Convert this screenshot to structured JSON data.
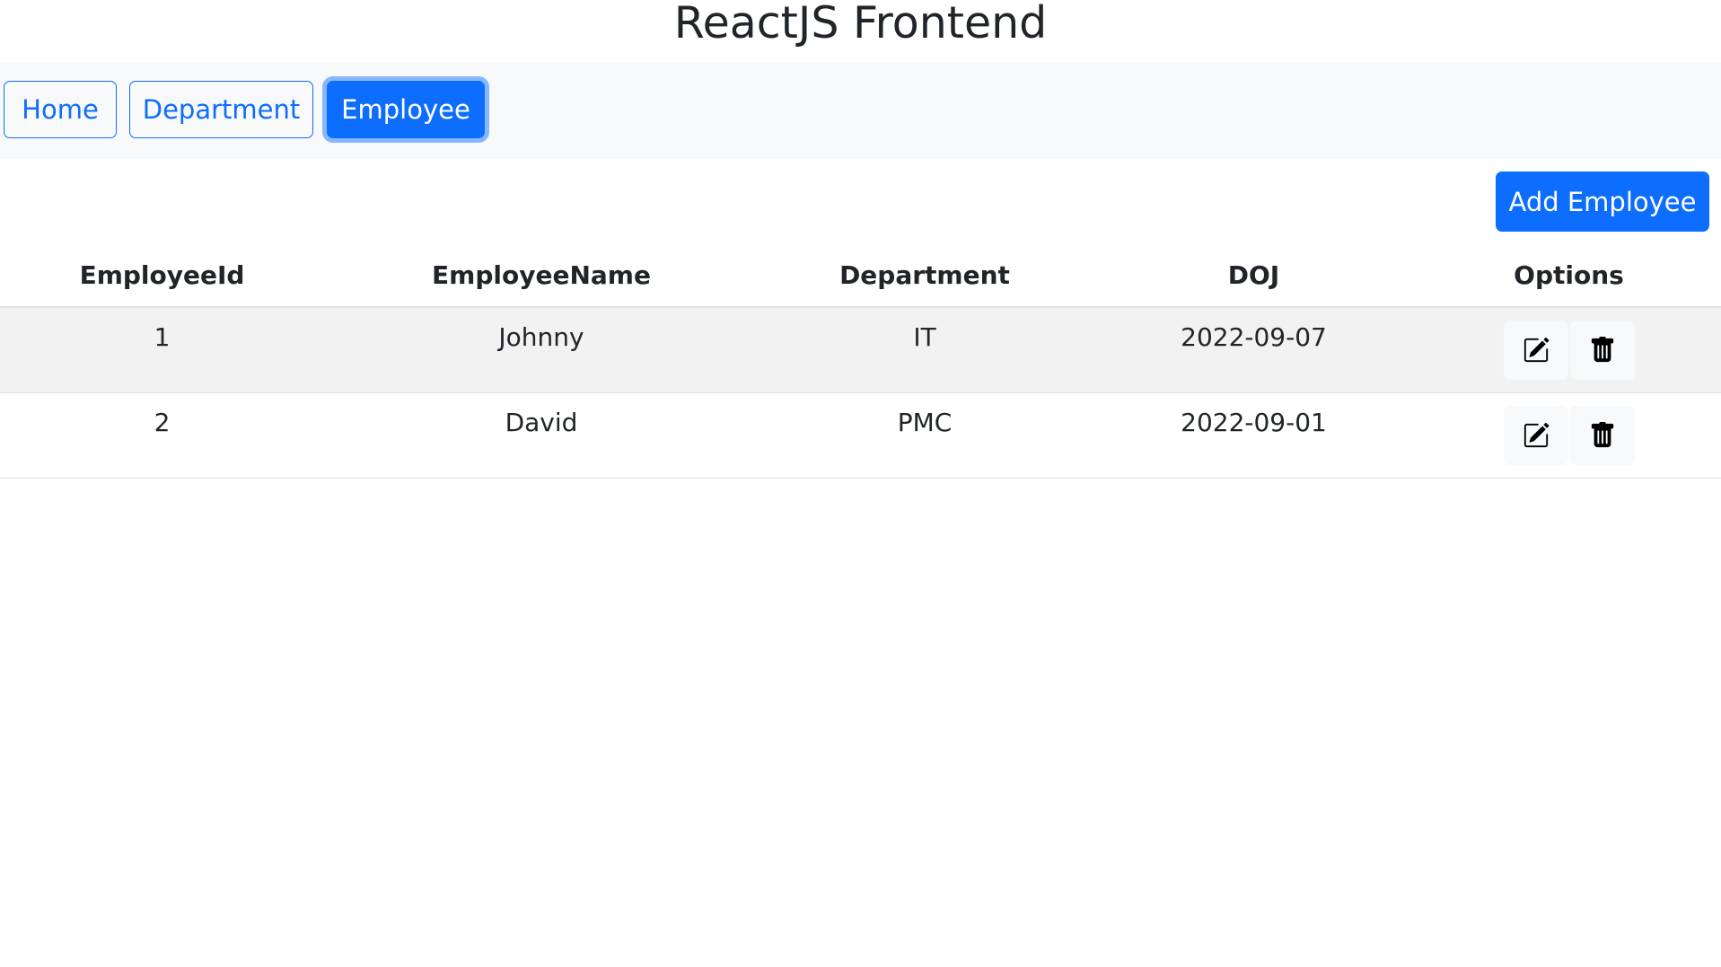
{
  "app": {
    "title": "ReactJS Frontend"
  },
  "nav": {
    "items": [
      {
        "label": "Home"
      },
      {
        "label": "Department"
      },
      {
        "label": "Employee"
      }
    ]
  },
  "toolbar": {
    "add_label": "Add Employee"
  },
  "table": {
    "headers": [
      "EmployeeId",
      "EmployeeName",
      "Department",
      "DOJ",
      "Options"
    ],
    "rows": [
      {
        "id": "1",
        "name": "Johnny",
        "department": "IT",
        "doj": "2022-09-07"
      },
      {
        "id": "2",
        "name": "David",
        "department": "PMC",
        "doj": "2022-09-01"
      }
    ]
  },
  "icons": {
    "edit": "edit-icon",
    "delete": "trash-icon"
  },
  "colors": {
    "accent": "#0d6efd",
    "focus_ring": "#86b7fe",
    "navbar_bg": "#f8f9fa",
    "row_stripe": "#f2f2f2"
  }
}
